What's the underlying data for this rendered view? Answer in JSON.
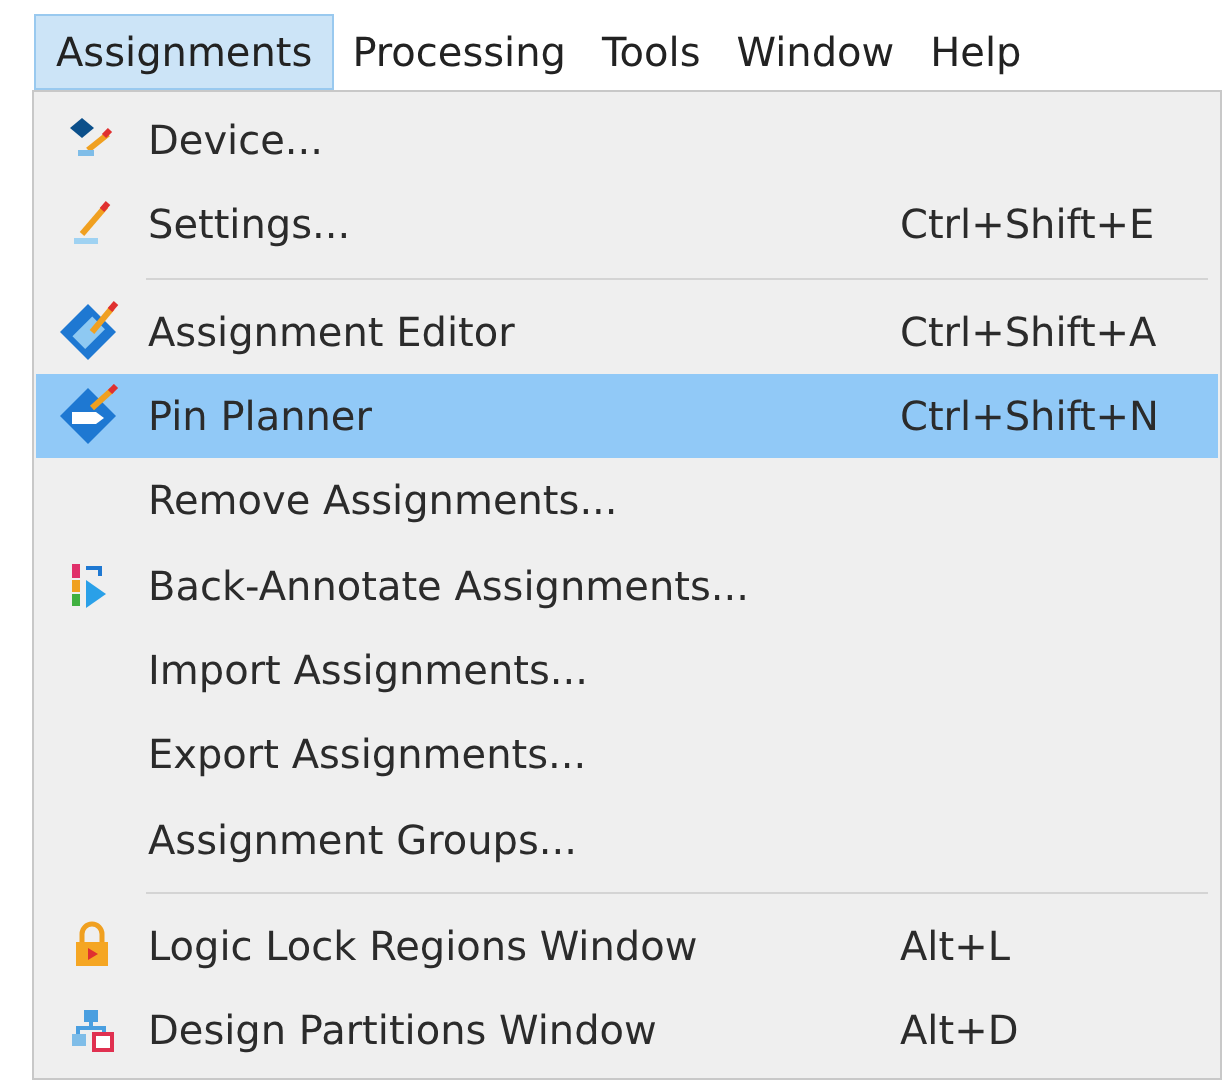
{
  "menubar": [
    {
      "label": "Assignments",
      "selected": true
    },
    {
      "label": "Processing",
      "selected": false
    },
    {
      "label": "Tools",
      "selected": false
    },
    {
      "label": "Window",
      "selected": false
    },
    {
      "label": "Help",
      "selected": false
    }
  ],
  "menu": [
    {
      "kind": "item",
      "label": "Device...",
      "selected": false
    },
    {
      "kind": "item",
      "label": "Settings...",
      "shortcut": "Ctrl+Shift+E",
      "selected": false
    },
    {
      "kind": "separator"
    },
    {
      "kind": "item",
      "label": "Assignment Editor",
      "shortcut": "Ctrl+Shift+A",
      "selected": false
    },
    {
      "kind": "item",
      "label": "Pin Planner",
      "shortcut": "Ctrl+Shift+N",
      "selected": true
    },
    {
      "kind": "item",
      "label": "Remove Assignments...",
      "selected": false
    },
    {
      "kind": "item",
      "label": "Back-Annotate Assignments...",
      "selected": false
    },
    {
      "kind": "item",
      "label": "Import Assignments...",
      "selected": false
    },
    {
      "kind": "item",
      "label": "Export Assignments...",
      "selected": false
    },
    {
      "kind": "item",
      "label": "Assignment Groups...",
      "selected": false
    },
    {
      "kind": "separator"
    },
    {
      "kind": "item",
      "label": "Logic Lock Regions Window",
      "shortcut": "Alt+L",
      "selected": false
    },
    {
      "kind": "item",
      "label": "Design Partitions Window",
      "shortcut": "Alt+D",
      "selected": false
    }
  ]
}
